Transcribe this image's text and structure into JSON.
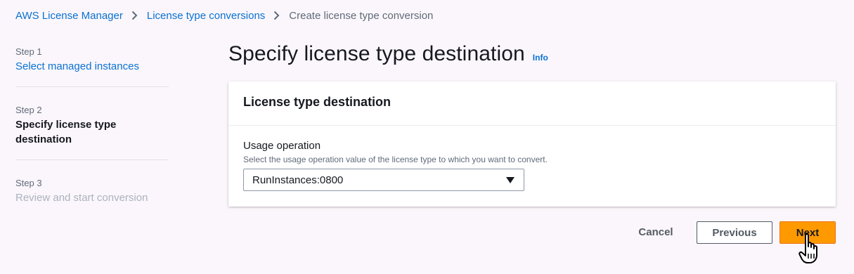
{
  "breadcrumb": {
    "items": [
      "AWS License Manager",
      "License type conversions"
    ],
    "current": "Create license type conversion"
  },
  "steps": [
    {
      "number": "Step 1",
      "title": "Select managed instances",
      "state": "completed"
    },
    {
      "number": "Step 2",
      "title": "Specify license type destination",
      "state": "active"
    },
    {
      "number": "Step 3",
      "title": "Review and start conversion",
      "state": "disabled"
    }
  ],
  "page": {
    "title": "Specify license type destination",
    "info_label": "Info"
  },
  "panel": {
    "title": "License type destination",
    "usage_operation": {
      "label": "Usage operation",
      "description": "Select the usage operation value of the license type to which you want to convert.",
      "selected_value": "RunInstances:0800"
    }
  },
  "actions": {
    "cancel": "Cancel",
    "previous": "Previous",
    "next": "Next"
  },
  "colors": {
    "link": "#0972d3",
    "primary_button": "#ff9900",
    "background": "#fbf6fb"
  },
  "icons": {
    "breadcrumb_separator": "chevron-right-icon",
    "select_caret": "caret-down-icon",
    "cursor": "hand-pointer-icon"
  }
}
